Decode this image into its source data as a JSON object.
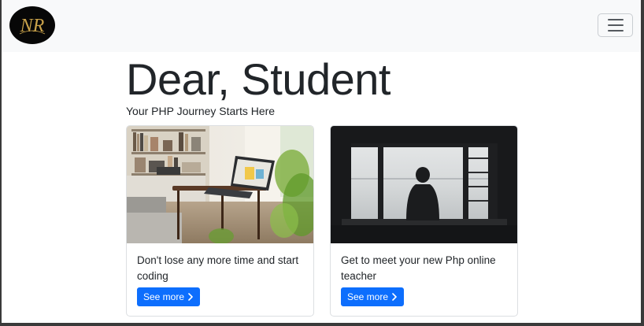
{
  "navbar": {
    "logo_text": "NR",
    "toggler_icon": "hamburger-menu-icon"
  },
  "hero": {
    "title": "Dear, Student",
    "subtitle": "Your PHP Journey Starts Here"
  },
  "cards": [
    {
      "image": "home-office-desk-with-laptop",
      "text": "Don't lose any more time and start coding",
      "button_label": "See more",
      "button_icon": "chevron-right-icon"
    },
    {
      "image": "person-silhouette-at-window",
      "text": "Get to meet your new Php online teacher",
      "button_label": "See more",
      "button_icon": "chevron-right-icon"
    }
  ],
  "colors": {
    "primary": "#0d6efd",
    "navbar_bg": "#f8f9fa",
    "text": "#212529",
    "logo_gold": "#c9a24a"
  }
}
